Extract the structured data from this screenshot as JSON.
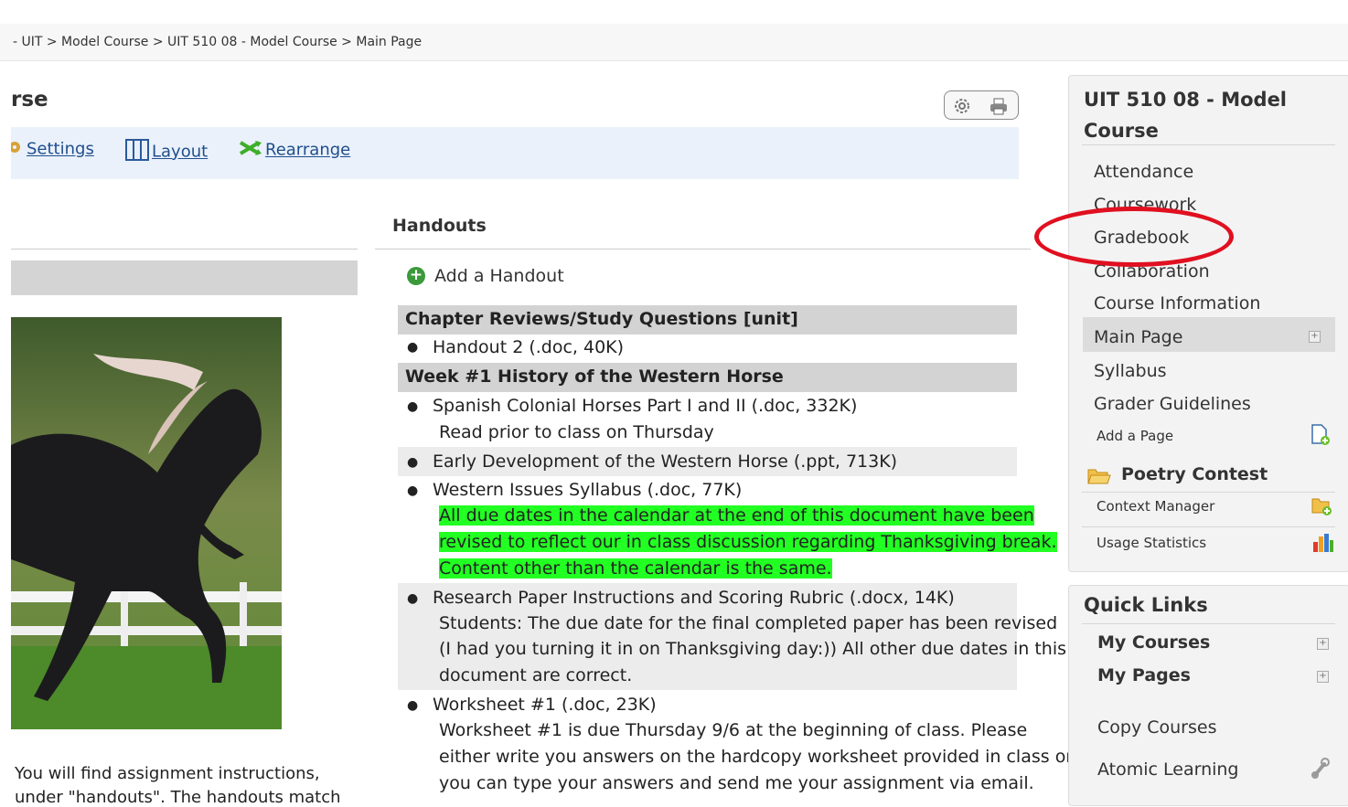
{
  "breadcrumb": "- UIT > Model Course > UIT 510 08 - Model Course > Main Page",
  "page_title": "rse",
  "toolbar": {
    "settings": "Settings",
    "layout": "Layout",
    "rearrange": "Rearrange"
  },
  "left_text": {
    "line1": "You will find assignment instructions,",
    "line2": "under \"handouts\". The handouts match"
  },
  "handouts": {
    "title": "Handouts",
    "add": "Add a Handout",
    "unit1": "Chapter Reviews/Study Questions [unit]",
    "unit1_items": [
      {
        "title": "Handout 2 (.doc, 40K)"
      }
    ],
    "unit2": "Week #1 History of the Western Horse",
    "unit2_items": [
      {
        "title": "Spanish Colonial Horses Part I and II (.doc, 332K)",
        "desc": [
          "Read prior to class on Thursday"
        ]
      },
      {
        "title": "Early Development of the Western Horse (.ppt, 713K)"
      },
      {
        "title": "Western Issues Syllabus (.doc, 77K)",
        "desc": [
          "All due dates in the calendar at the end of this document have been",
          "revised to reflect our in class discussion regarding Thanksgiving break.",
          "Content other than the calendar is the same."
        ]
      },
      {
        "title": "Research Paper Instructions and Scoring Rubric (.docx, 14K)",
        "desc": [
          "Students:  The due date for the final completed paper has been revised",
          "(I had you turning it in on Thanksgiving day:)) All other due dates in this",
          "document are correct."
        ]
      },
      {
        "title": "Worksheet #1 (.doc, 23K)",
        "desc": [
          "Worksheet #1 is due Thursday 9/6 at the beginning of class.  Please",
          "either write you answers on the hardcopy worksheet provided in class or",
          "you can type your answers and send me your assignment via email."
        ]
      }
    ]
  },
  "sidebar": {
    "title_line1": "UIT 510 08 - Model",
    "title_line2": "Course",
    "items": [
      "Attendance",
      "Coursework",
      "Gradebook",
      "Collaboration",
      "Course Information",
      "Main Page",
      "Syllabus",
      "Grader Guidelines"
    ],
    "add_page": "Add a Page",
    "folder": "Poetry Contest",
    "context_manager": "Context Manager",
    "usage_statistics": "Usage Statistics"
  },
  "quick_links": {
    "title": "Quick Links",
    "my_courses": "My Courses",
    "my_pages": "My Pages",
    "copy_courses": "Copy Courses",
    "atomic_learning": "Atomic Learning"
  },
  "colors": {
    "highlight": "#22ff22",
    "annotation": "#e01020",
    "link": "#1f4e8c"
  }
}
